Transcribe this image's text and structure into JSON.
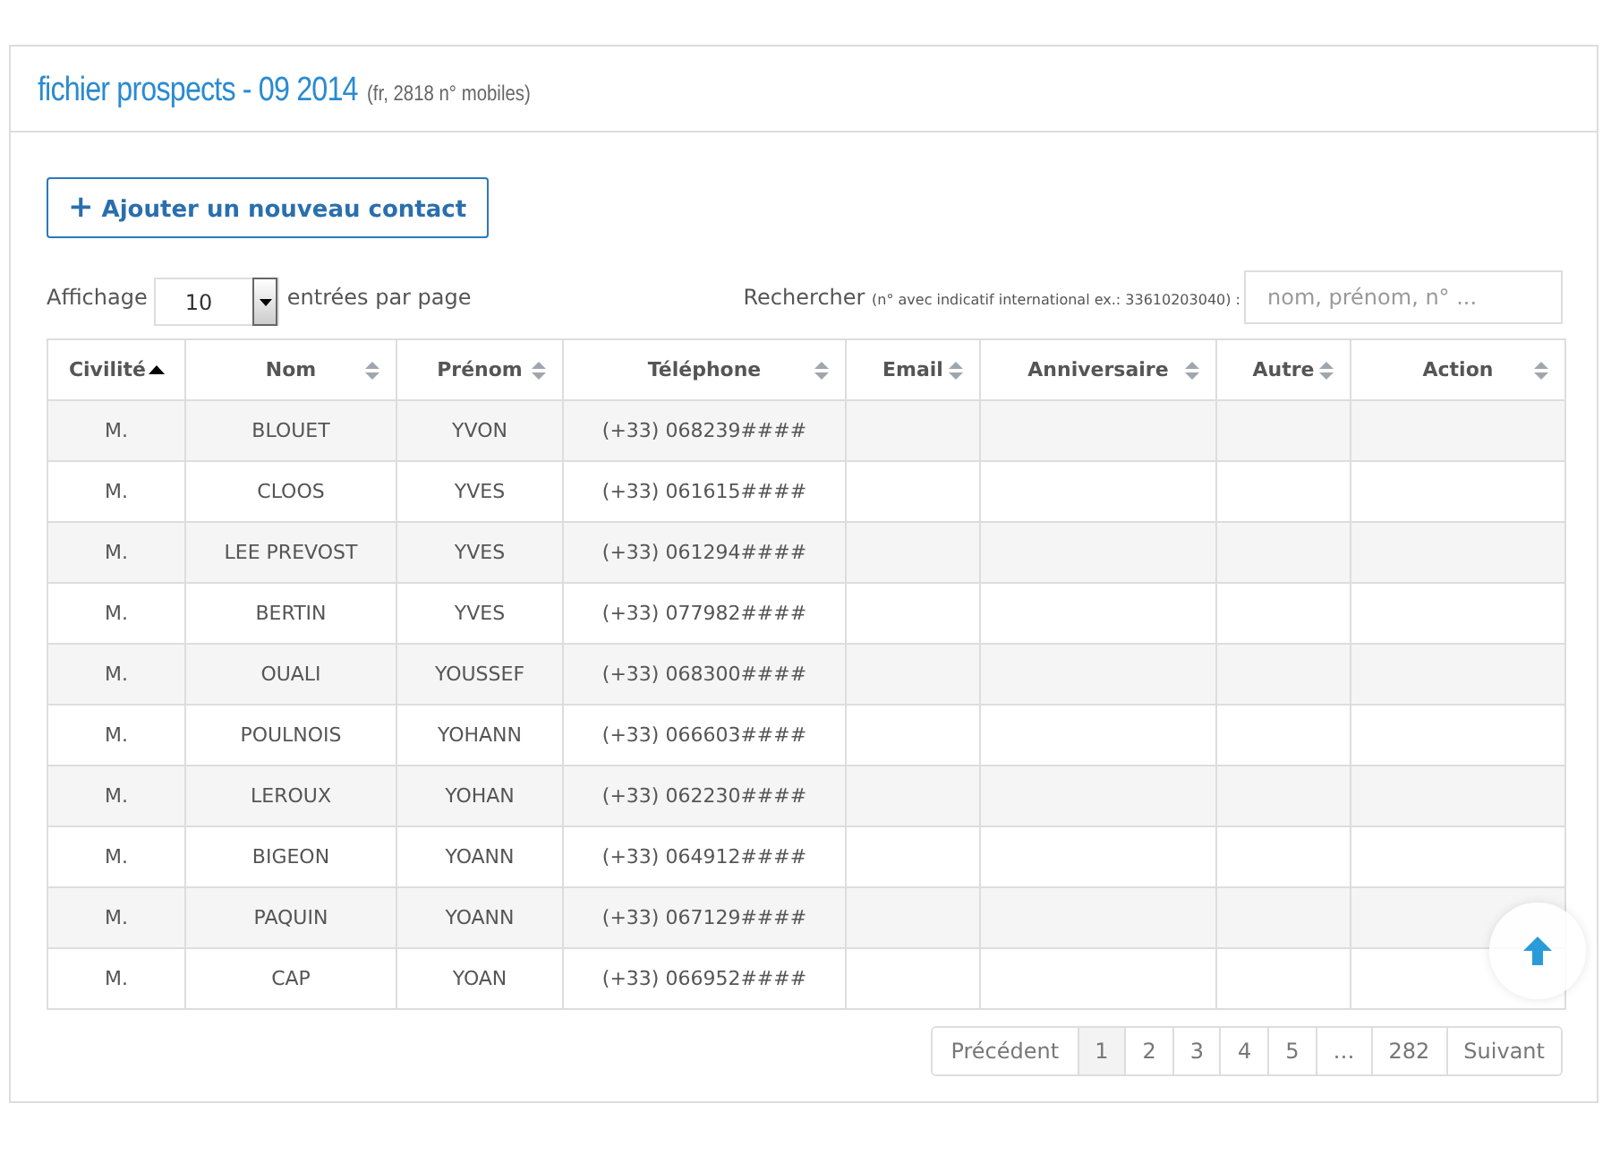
{
  "panel": {
    "title": "fichier prospects - 09 2014",
    "subtitle": "(fr, 2818 n° mobiles)"
  },
  "add_button": {
    "icon": "+",
    "label": "Ajouter un nouveau contact"
  },
  "page_length": {
    "label_before": "Affichage",
    "value": "10",
    "label_after": "entrées par page"
  },
  "search": {
    "label": "Rechercher",
    "hint": "(n° avec indicatif international ex.: 33610203040) :",
    "placeholder": "nom, prénom, n° ..."
  },
  "table": {
    "columns": [
      {
        "label": "Civilité",
        "sorted_ascending": true
      },
      {
        "label": "Nom",
        "sorted_ascending": false
      },
      {
        "label": "Prénom",
        "sorted_ascending": false
      },
      {
        "label": "Téléphone",
        "sorted_ascending": false
      },
      {
        "label": "Email",
        "sorted_ascending": false
      },
      {
        "label": "Anniversaire",
        "sorted_ascending": false
      },
      {
        "label": "Autre",
        "sorted_ascending": false
      },
      {
        "label": "Action",
        "sorted_ascending": false
      }
    ],
    "rows": [
      [
        "M.",
        "BLOUET",
        "YVON",
        "(+33) 068239####"
      ],
      [
        "M.",
        "CLOOS",
        "YVES",
        "(+33) 061615####"
      ],
      [
        "M.",
        "LEE PREVOST",
        "YVES",
        "(+33) 061294####"
      ],
      [
        "M.",
        "BERTIN",
        "YVES",
        "(+33) 077982####"
      ],
      [
        "M.",
        "OUALI",
        "YOUSSEF",
        "(+33) 068300####"
      ],
      [
        "M.",
        "POULNOIS",
        "YOHANN",
        "(+33) 066603####"
      ],
      [
        "M.",
        "LEROUX",
        "YOHAN",
        "(+33) 062230####"
      ],
      [
        "M.",
        "BIGEON",
        "YOANN",
        "(+33) 064912####"
      ],
      [
        "M.",
        "PAQUIN",
        "YOANN",
        "(+33) 067129####"
      ],
      [
        "M.",
        "CAP",
        "YOAN",
        "(+33) 066952####"
      ]
    ]
  },
  "pagination": [
    {
      "label": "Précédent",
      "selected": false
    },
    {
      "label": "1",
      "selected": true
    },
    {
      "label": "2",
      "selected": false
    },
    {
      "label": "3",
      "selected": false
    },
    {
      "label": "4",
      "selected": false
    },
    {
      "label": "5",
      "selected": false
    },
    {
      "label": "…",
      "selected": false
    },
    {
      "label": "282",
      "selected": false
    },
    {
      "label": "Suivant",
      "selected": false
    }
  ]
}
